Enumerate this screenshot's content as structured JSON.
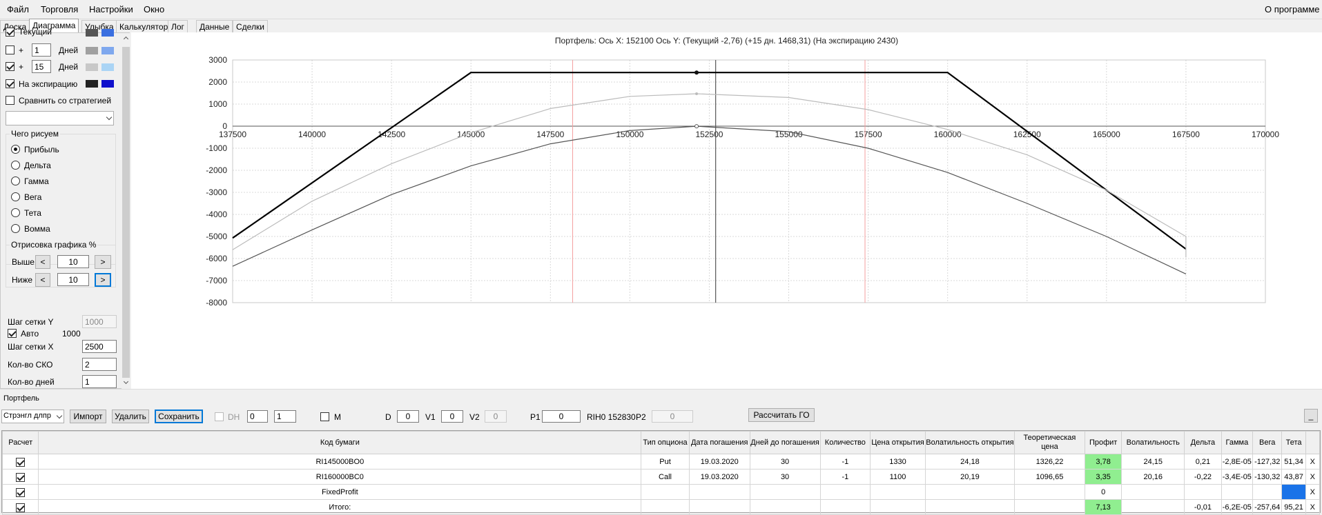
{
  "menu": {
    "file": "Файл",
    "trade": "Торговля",
    "settings": "Настройки",
    "window": "Окно",
    "about": "О программе"
  },
  "tabs": [
    "Доска",
    "Диаграмма",
    "Улыбка",
    "Калькулятор",
    "Лог",
    "Данные",
    "Сделки"
  ],
  "left": {
    "current_label": "Текущий",
    "days_label": "Дней",
    "plus": "+",
    "days1": "1",
    "days2": "15",
    "expiry_label": "На экспирацию",
    "compare_label": "Сравнить со стратегией",
    "what_title": "Чего рисуем",
    "radios": [
      "Прибыль",
      "Дельта",
      "Гамма",
      "Вега",
      "Тета",
      "Вомма"
    ],
    "draw_title": "Отрисовка графика %",
    "above": "Выше",
    "below": "Ниже",
    "above_val": "10",
    "below_val": "10",
    "lt": "<",
    "gt": ">",
    "grid_y_label": "Шаг сетки Y",
    "grid_y_val": "1000",
    "auto_label": "Авто",
    "auto_val": "1000",
    "grid_x_label": "Шаг сетки X",
    "grid_x_val": "2500",
    "sko_label": "Кол-во СКО",
    "sko_val": "2",
    "days_count_label": "Кол-во дней",
    "days_count_val": "1",
    "swatches": [
      "#555555",
      "#3a6fe0",
      "#a0a0a0",
      "#7fa8ee",
      "#c8c8c8",
      "#aad4f5",
      "#222222",
      "#1010cc"
    ]
  },
  "chart_data": {
    "type": "line",
    "title": "Портфель: Ось X: 152100 Ось Y:  (Текущий -2,76)  (+15 дн. 1468,31)  (На экспирацию 2430)",
    "xlim": [
      137500,
      170000
    ],
    "ylim": [
      -8000,
      3000
    ],
    "xticks": [
      "137500",
      "140000",
      "142500",
      "145000",
      "147500",
      "150000",
      "152500",
      "155000",
      "157500",
      "160000",
      "162500",
      "165000",
      "167500",
      "170000"
    ],
    "yticks": [
      "3000",
      "2000",
      "1000",
      "0",
      "-1000",
      "-2000",
      "-3000",
      "-4000",
      "-5000",
      "-6000",
      "-7000",
      "-8000"
    ],
    "grid": true,
    "cursor_x": 152100,
    "current_price_x": 152700,
    "sigma_lines_x": [
      148200,
      157400
    ],
    "series": [
      {
        "color": "#000000",
        "points": [
          [
            137500,
            -5070
          ],
          [
            145000,
            2430
          ],
          [
            160000,
            2430
          ],
          [
            167500,
            -5570
          ]
        ]
      },
      {
        "color": "#bbbbbb",
        "points": [
          [
            137500,
            -5600
          ],
          [
            140000,
            -3400
          ],
          [
            142500,
            -1700
          ],
          [
            145000,
            -300
          ],
          [
            147500,
            800
          ],
          [
            150000,
            1350
          ],
          [
            152100,
            1468
          ],
          [
            155000,
            1300
          ],
          [
            157500,
            750
          ],
          [
            160000,
            -150
          ],
          [
            162500,
            -1300
          ],
          [
            165000,
            -2900
          ],
          [
            167500,
            -5000
          ],
          [
            167500,
            -5950
          ]
        ]
      },
      {
        "color": "#555555",
        "points": [
          [
            137500,
            -6350
          ],
          [
            140000,
            -4700
          ],
          [
            142500,
            -3100
          ],
          [
            145000,
            -1800
          ],
          [
            147500,
            -800
          ],
          [
            150000,
            -200
          ],
          [
            152100,
            -3
          ],
          [
            155000,
            -250
          ],
          [
            157500,
            -1000
          ],
          [
            160000,
            -2100
          ],
          [
            162500,
            -3500
          ],
          [
            165000,
            -5000
          ],
          [
            167500,
            -6700
          ]
        ]
      }
    ]
  },
  "portfolio": {
    "title": "Портфель",
    "strategy": "Стрэнгл длпр",
    "import": "Импорт",
    "delete": "Удалить",
    "save": "Сохранить",
    "dh": "DH",
    "dh1": "0",
    "dh2": "1",
    "m": "M",
    "d_label": "D",
    "d_val": "0",
    "v1_label": "V1",
    "v1_val": "0",
    "v2_label": "V2",
    "v2_val": "0",
    "p1_label": "P1",
    "p1_val": "0",
    "rih": "RIH0 152830",
    "p2_label": "P2",
    "p2_val": "0",
    "go": "Рассчитать ГО",
    "min": "_"
  },
  "table": {
    "headers": [
      "Расчет",
      "Код бумаги",
      "Тип опциона",
      "Дата погашения",
      "Дней до погашения",
      "Количество",
      "Цена открытия",
      "Волатильность открытия",
      "Теоретическая цена",
      "Профит",
      "Волатильность",
      "Дельта",
      "Гамма",
      "Вега",
      "Тета",
      ""
    ],
    "rows": [
      [
        "RI145000BO0",
        "Put",
        "19.03.2020",
        "30",
        "-1",
        "1330",
        "24,18",
        "1326,22",
        "3,78",
        "24,15",
        "0,21",
        "-2,8E-05",
        "-127,32",
        "51,34",
        "X"
      ],
      [
        "RI160000BC0",
        "Call",
        "19.03.2020",
        "30",
        "-1",
        "1100",
        "20,19",
        "1096,65",
        "3,35",
        "20,16",
        "-0,22",
        "-3,4E-05",
        "-130,32",
        "43,87",
        "X"
      ],
      [
        "FixedProfit",
        "",
        "",
        "",
        "",
        "",
        "",
        "",
        "0",
        "",
        "",
        "",
        "",
        "",
        "X"
      ],
      [
        "Итого:",
        "",
        "",
        "",
        "",
        "",
        "",
        "",
        "7,13",
        "",
        "-0,01",
        "-6,2E-05",
        "-257,64",
        "95,21",
        "X"
      ]
    ]
  }
}
